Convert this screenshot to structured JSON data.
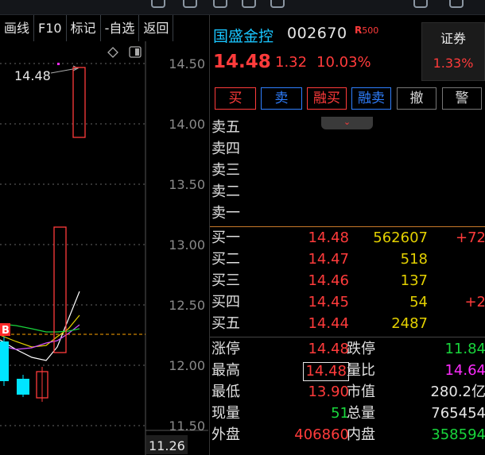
{
  "toolbar": {
    "items": [
      "画线",
      "F10",
      "标记",
      "-自选",
      "返回"
    ]
  },
  "chart": {
    "price_ticks": [
      "14.50",
      "14.00",
      "13.50",
      "13.00",
      "12.50",
      "12.00",
      "11.50"
    ],
    "high_label": "14.48",
    "bottom_value": "11.26",
    "signal_badge": "B",
    "colors": {
      "up": "#ff3b3b",
      "down": "#00e5ff",
      "ma1": "#ffffff",
      "ma2": "#e3d000",
      "ma3": "#d050ff",
      "ma4": "#19d63c",
      "ref_line": "#ffa500"
    }
  },
  "quote": {
    "name": "国盛金控",
    "code": "002670",
    "badge_r": "R",
    "badge_num": "500",
    "price": "14.48",
    "change": "1.32",
    "change_pct": "10.03%",
    "sector": {
      "name": "证券",
      "pct": "1.33%"
    }
  },
  "trade_buttons": [
    "买",
    "卖",
    "融买",
    "融卖",
    "撤",
    "警"
  ],
  "order_book": {
    "sell": [
      {
        "label": "卖五"
      },
      {
        "label": "卖四"
      },
      {
        "label": "卖三"
      },
      {
        "label": "卖二"
      },
      {
        "label": "卖一"
      }
    ],
    "buy": [
      {
        "label": "买一",
        "price": "14.48",
        "volume": "562607",
        "delta": "+72"
      },
      {
        "label": "买二",
        "price": "14.47",
        "volume": "518",
        "delta": ""
      },
      {
        "label": "买三",
        "price": "14.46",
        "volume": "137",
        "delta": ""
      },
      {
        "label": "买四",
        "price": "14.45",
        "volume": "54",
        "delta": "+2"
      },
      {
        "label": "买五",
        "price": "14.44",
        "volume": "2487",
        "delta": ""
      }
    ]
  },
  "stats": [
    {
      "l1": "涨停",
      "v1": "14.48",
      "l2": "跌停",
      "v2": "11.84"
    },
    {
      "l1": "最高",
      "v1": "14.48",
      "l2": "量比",
      "v2": "14.64"
    },
    {
      "l1": "最低",
      "v1": "13.90",
      "l2": "市值",
      "v2": "280.2亿"
    },
    {
      "l1": "现量",
      "v1": "51",
      "l2": "总量",
      "v2": "765454"
    },
    {
      "l1": "外盘",
      "v1": "406860",
      "l2": "内盘",
      "v2": "358594"
    }
  ]
}
